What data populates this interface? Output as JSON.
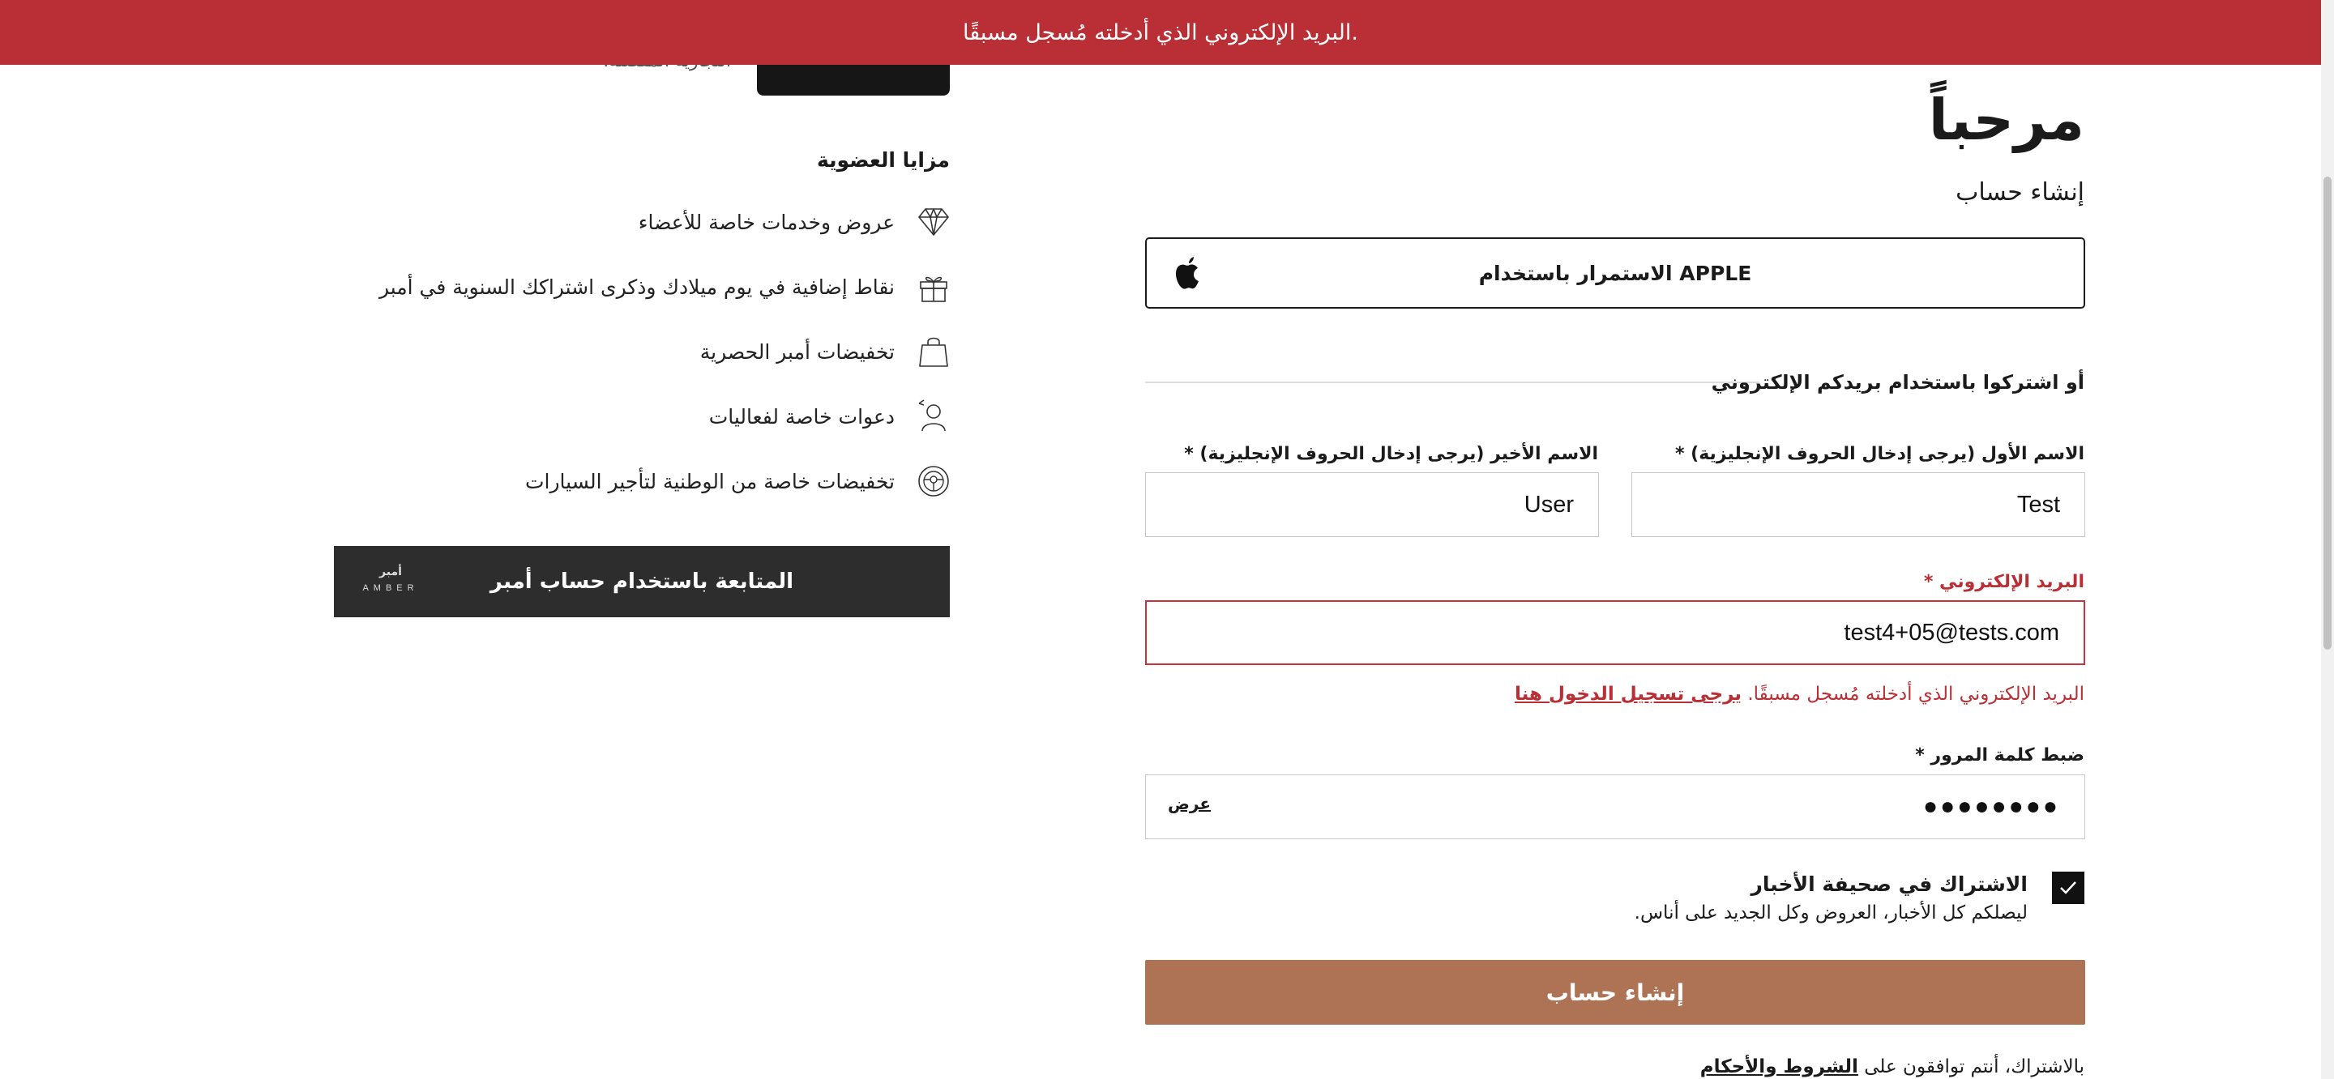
{
  "banner": {
    "message": "البريد الإلكتروني الذي أدخلته مُسجل مسبقًا."
  },
  "header": {
    "welcome": "مرحباً",
    "create_account_subtitle": "إنشاء حساب"
  },
  "apple": {
    "label": "الاستمرار باستخدام APPLE",
    "icon": "apple-icon"
  },
  "divider": {
    "text": "أو اشتركوا باستخدام بريدكم الإلكتروني"
  },
  "form": {
    "first_name": {
      "label": "الاسم الأول (يرجى إدخال الحروف الإنجليزية) *",
      "value": "Test"
    },
    "last_name": {
      "label": "الاسم الأخير (يرجى إدخال الحروف الإنجليزية) *",
      "value": "User"
    },
    "email": {
      "label": "البريد الإلكتروني *",
      "value": "test4+05@tests.com",
      "error": "البريد الإلكتروني الذي أدخلته مُسجل مسبقًا.",
      "error_link": "يرجى تسجيل الدخول هنا"
    },
    "password": {
      "label": "ضبط كلمة المرور *",
      "value": "●●●●●●●●",
      "show_label": "عرض"
    },
    "newsletter": {
      "title": "الاشتراك في صحيفة الأخبار",
      "subtitle": "ليصلكم كل الأخبار، العروض وكل الجديد على أناس.",
      "checked": true
    },
    "submit_label": "إنشاء حساب",
    "terms_prefix": "بالاشتراك، أنتم توافقون على",
    "terms_link": "الشروط والأحكام"
  },
  "benefits": {
    "cut_text": "التجارية المفضلة.",
    "title": "مزايا العضوية",
    "items": [
      {
        "label": "عروض وخدمات خاصة للأعضاء",
        "icon": "diamond-icon"
      },
      {
        "label": "نقاط إضافية في يوم ميلادك وذكرى اشتراكك السنوية في أمبر",
        "icon": "gift-icon"
      },
      {
        "label": "تخفيضات أمبر الحصرية",
        "icon": "shopping-bag-icon"
      },
      {
        "label": "دعوات خاصة لفعاليات",
        "icon": "user-invite-icon"
      },
      {
        "label": "تخفيضات خاصة من الوطنية لتأجير السيارات",
        "icon": "steering-wheel-icon"
      }
    ]
  },
  "amber": {
    "button_label": "المتابعة باستخدام حساب أمبر",
    "logo_ar": "أمبر",
    "logo_en": "AMBER"
  },
  "colors": {
    "error": "#b92f35",
    "primary_button": "#ae7354",
    "dark": "#2d2d2d"
  }
}
